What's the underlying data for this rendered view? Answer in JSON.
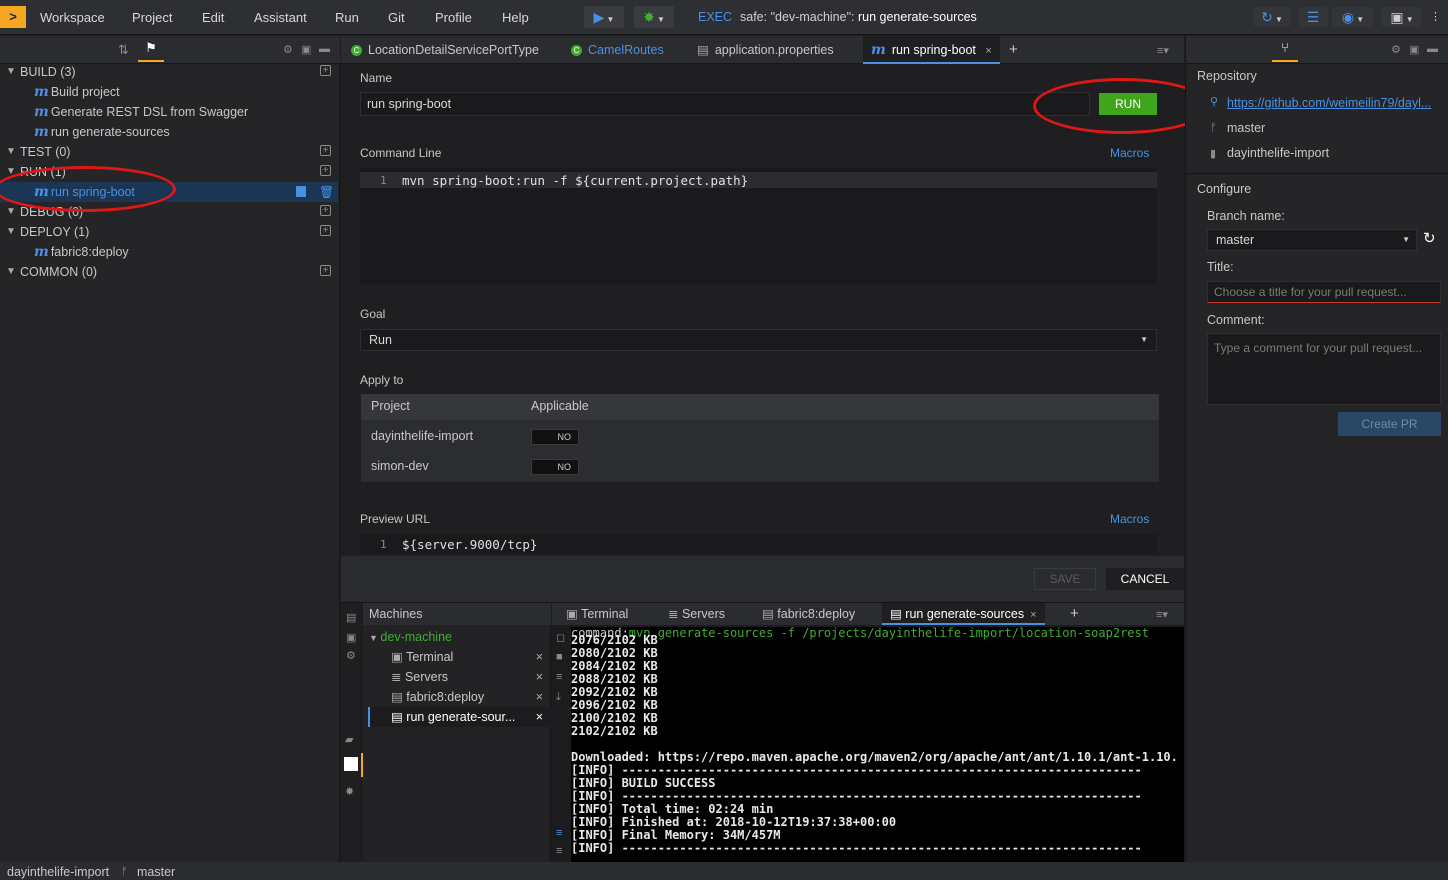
{
  "menubar": {
    "logo": ">",
    "items": [
      "Workspace",
      "Project",
      "Edit",
      "Assistant",
      "Run",
      "Git",
      "Profile",
      "Help"
    ],
    "exec_label": "EXEC",
    "exec_prefix": "safe: \"dev-machine\": ",
    "exec_command": "run generate-sources"
  },
  "left_panel": {
    "groups": [
      {
        "label": "BUILD (3)",
        "items": [
          "Build project",
          "Generate REST DSL from Swagger",
          "run generate-sources"
        ]
      },
      {
        "label": "TEST (0)",
        "items": []
      },
      {
        "label": "RUN (1)",
        "items": [
          "run spring-boot"
        ]
      },
      {
        "label": "DEBUG (0)",
        "items": []
      },
      {
        "label": "DEPLOY (1)",
        "items": [
          "fabric8:deploy"
        ]
      },
      {
        "label": "COMMON (0)",
        "items": []
      }
    ],
    "item_icon": "m"
  },
  "tabs": [
    {
      "label": "LocationDetailServicePortType",
      "icon": "camel-class-icon"
    },
    {
      "label": "CamelRoutes",
      "icon": "camel-class-icon"
    },
    {
      "label": "application.properties",
      "icon": "file-icon"
    },
    {
      "label": "run spring-boot",
      "icon": "maven-icon",
      "active": true
    }
  ],
  "form": {
    "name_label": "Name",
    "name_value": "run spring-boot",
    "run_button": "RUN",
    "command_label": "Command Line",
    "macros_label": "Macros",
    "command_line_num": "1",
    "command_text": "mvn spring-boot:run -f ${current.project.path}",
    "goal_label": "Goal",
    "goal_value": "Run",
    "apply_label": "Apply to",
    "apply_headers": [
      "Project",
      "Applicable"
    ],
    "apply_rows": [
      {
        "project": "dayinthelife-import",
        "applicable": "NO"
      },
      {
        "project": "simon-dev",
        "applicable": "NO"
      }
    ],
    "preview_label": "Preview URL",
    "preview_line_num": "1",
    "preview_text": "${server.9000/tcp}",
    "save_button": "SAVE",
    "cancel_button": "CANCEL"
  },
  "machines": {
    "title": "Machines",
    "machine": "dev-machine",
    "items": [
      "Terminal",
      "Servers",
      "fabric8:deploy",
      "run generate-sour..."
    ]
  },
  "bottom_tabs": [
    "Terminal",
    "Servers",
    "fabric8:deploy",
    "run generate-sources"
  ],
  "console": {
    "command_prefix": "command:",
    "command": "mvn generate-sources -f /projects/dayinthelife-import/location-soap2rest",
    "lines": [
      "2076/2102 KB",
      "2080/2102 KB",
      "2084/2102 KB",
      "2088/2102 KB",
      "2092/2102 KB",
      "2096/2102 KB",
      "2100/2102 KB",
      "2102/2102 KB",
      "",
      "Downloaded: https://repo.maven.apache.org/maven2/org/apache/ant/ant/1.10.1/ant-1.10.",
      "[INFO] ------------------------------------------------------------------------",
      "[INFO] BUILD SUCCESS",
      "[INFO] ------------------------------------------------------------------------",
      "[INFO] Total time: 02:24 min",
      "[INFO] Finished at: 2018-10-12T19:37:38+00:00",
      "[INFO] Final Memory: 34M/457M",
      "[INFO] ------------------------------------------------------------------------"
    ]
  },
  "right_panel": {
    "repository_label": "Repository",
    "repo_url": "https://github.com/weimeilin79/dayl...",
    "branch": "master",
    "project": "dayinthelife-import",
    "configure_label": "Configure",
    "branch_name_label": "Branch name:",
    "branch_name_value": "master",
    "title_label": "Title:",
    "title_placeholder": "Choose a title for your pull request...",
    "comment_label": "Comment:",
    "comment_placeholder": "Type a comment for your pull request...",
    "create_pr_button": "Create PR"
  },
  "statusbar": {
    "project": "dayinthelife-import",
    "branch": "master"
  },
  "colors": {
    "accent": "#4a90e2",
    "run_green": "#3fa51b",
    "annotation_red": "#e01717",
    "logo_orange": "#f5a623"
  }
}
